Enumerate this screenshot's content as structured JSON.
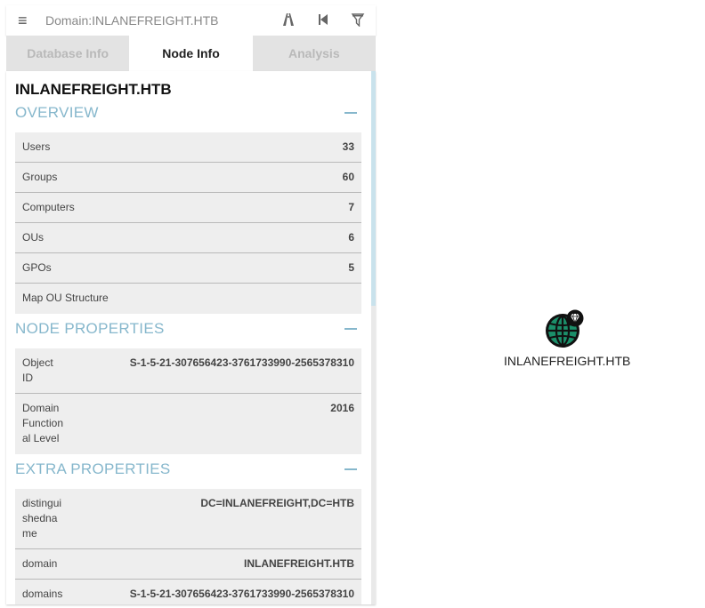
{
  "search": {
    "value": "Domain:INLANEFREIGHT.HTB",
    "menu_icon": "hamburger-icon",
    "toolbar_icons": [
      "pathfinding-icon",
      "back-icon",
      "filter-icon"
    ]
  },
  "tabs": [
    {
      "label": "Database Info",
      "active": false
    },
    {
      "label": "Node Info",
      "active": true
    },
    {
      "label": "Analysis",
      "active": false
    }
  ],
  "node": {
    "title": "INLANEFREIGHT.HTB"
  },
  "overview": {
    "heading": "OVERVIEW",
    "rows": [
      {
        "key": "Users",
        "value": "33"
      },
      {
        "key": "Groups",
        "value": "60"
      },
      {
        "key": "Computers",
        "value": "7"
      },
      {
        "key": "OUs",
        "value": "6"
      },
      {
        "key": "GPOs",
        "value": "5"
      },
      {
        "key": "Map OU Structure",
        "value": ""
      }
    ]
  },
  "node_properties": {
    "heading": "NODE PROPERTIES",
    "rows": [
      {
        "key_lines": [
          "Object",
          "ID"
        ],
        "value": "S-1-5-21-307656423-3761733990-2565378310"
      },
      {
        "key_lines": [
          "Domain",
          "Function",
          "al Level"
        ],
        "value": "2016"
      }
    ]
  },
  "extra_properties": {
    "heading": "EXTRA PROPERTIES",
    "rows": [
      {
        "key_lines": [
          "distingui",
          "shedna",
          "me"
        ],
        "value": "DC=INLANEFREIGHT,DC=HTB"
      },
      {
        "key_lines": [
          "domain"
        ],
        "value": "INLANEFREIGHT.HTB"
      },
      {
        "key_lines": [
          "domains"
        ],
        "value": "S-1-5-21-307656423-3761733990-2565378310"
      }
    ]
  },
  "graph": {
    "node_label": "INLANEFREIGHT.HTB",
    "node_icon": "globe-domain-icon",
    "badge_icon": "diamond-badge-icon"
  },
  "colors": {
    "section_accent": "#86b7cc",
    "globe_fill": "#1b8f6a"
  }
}
